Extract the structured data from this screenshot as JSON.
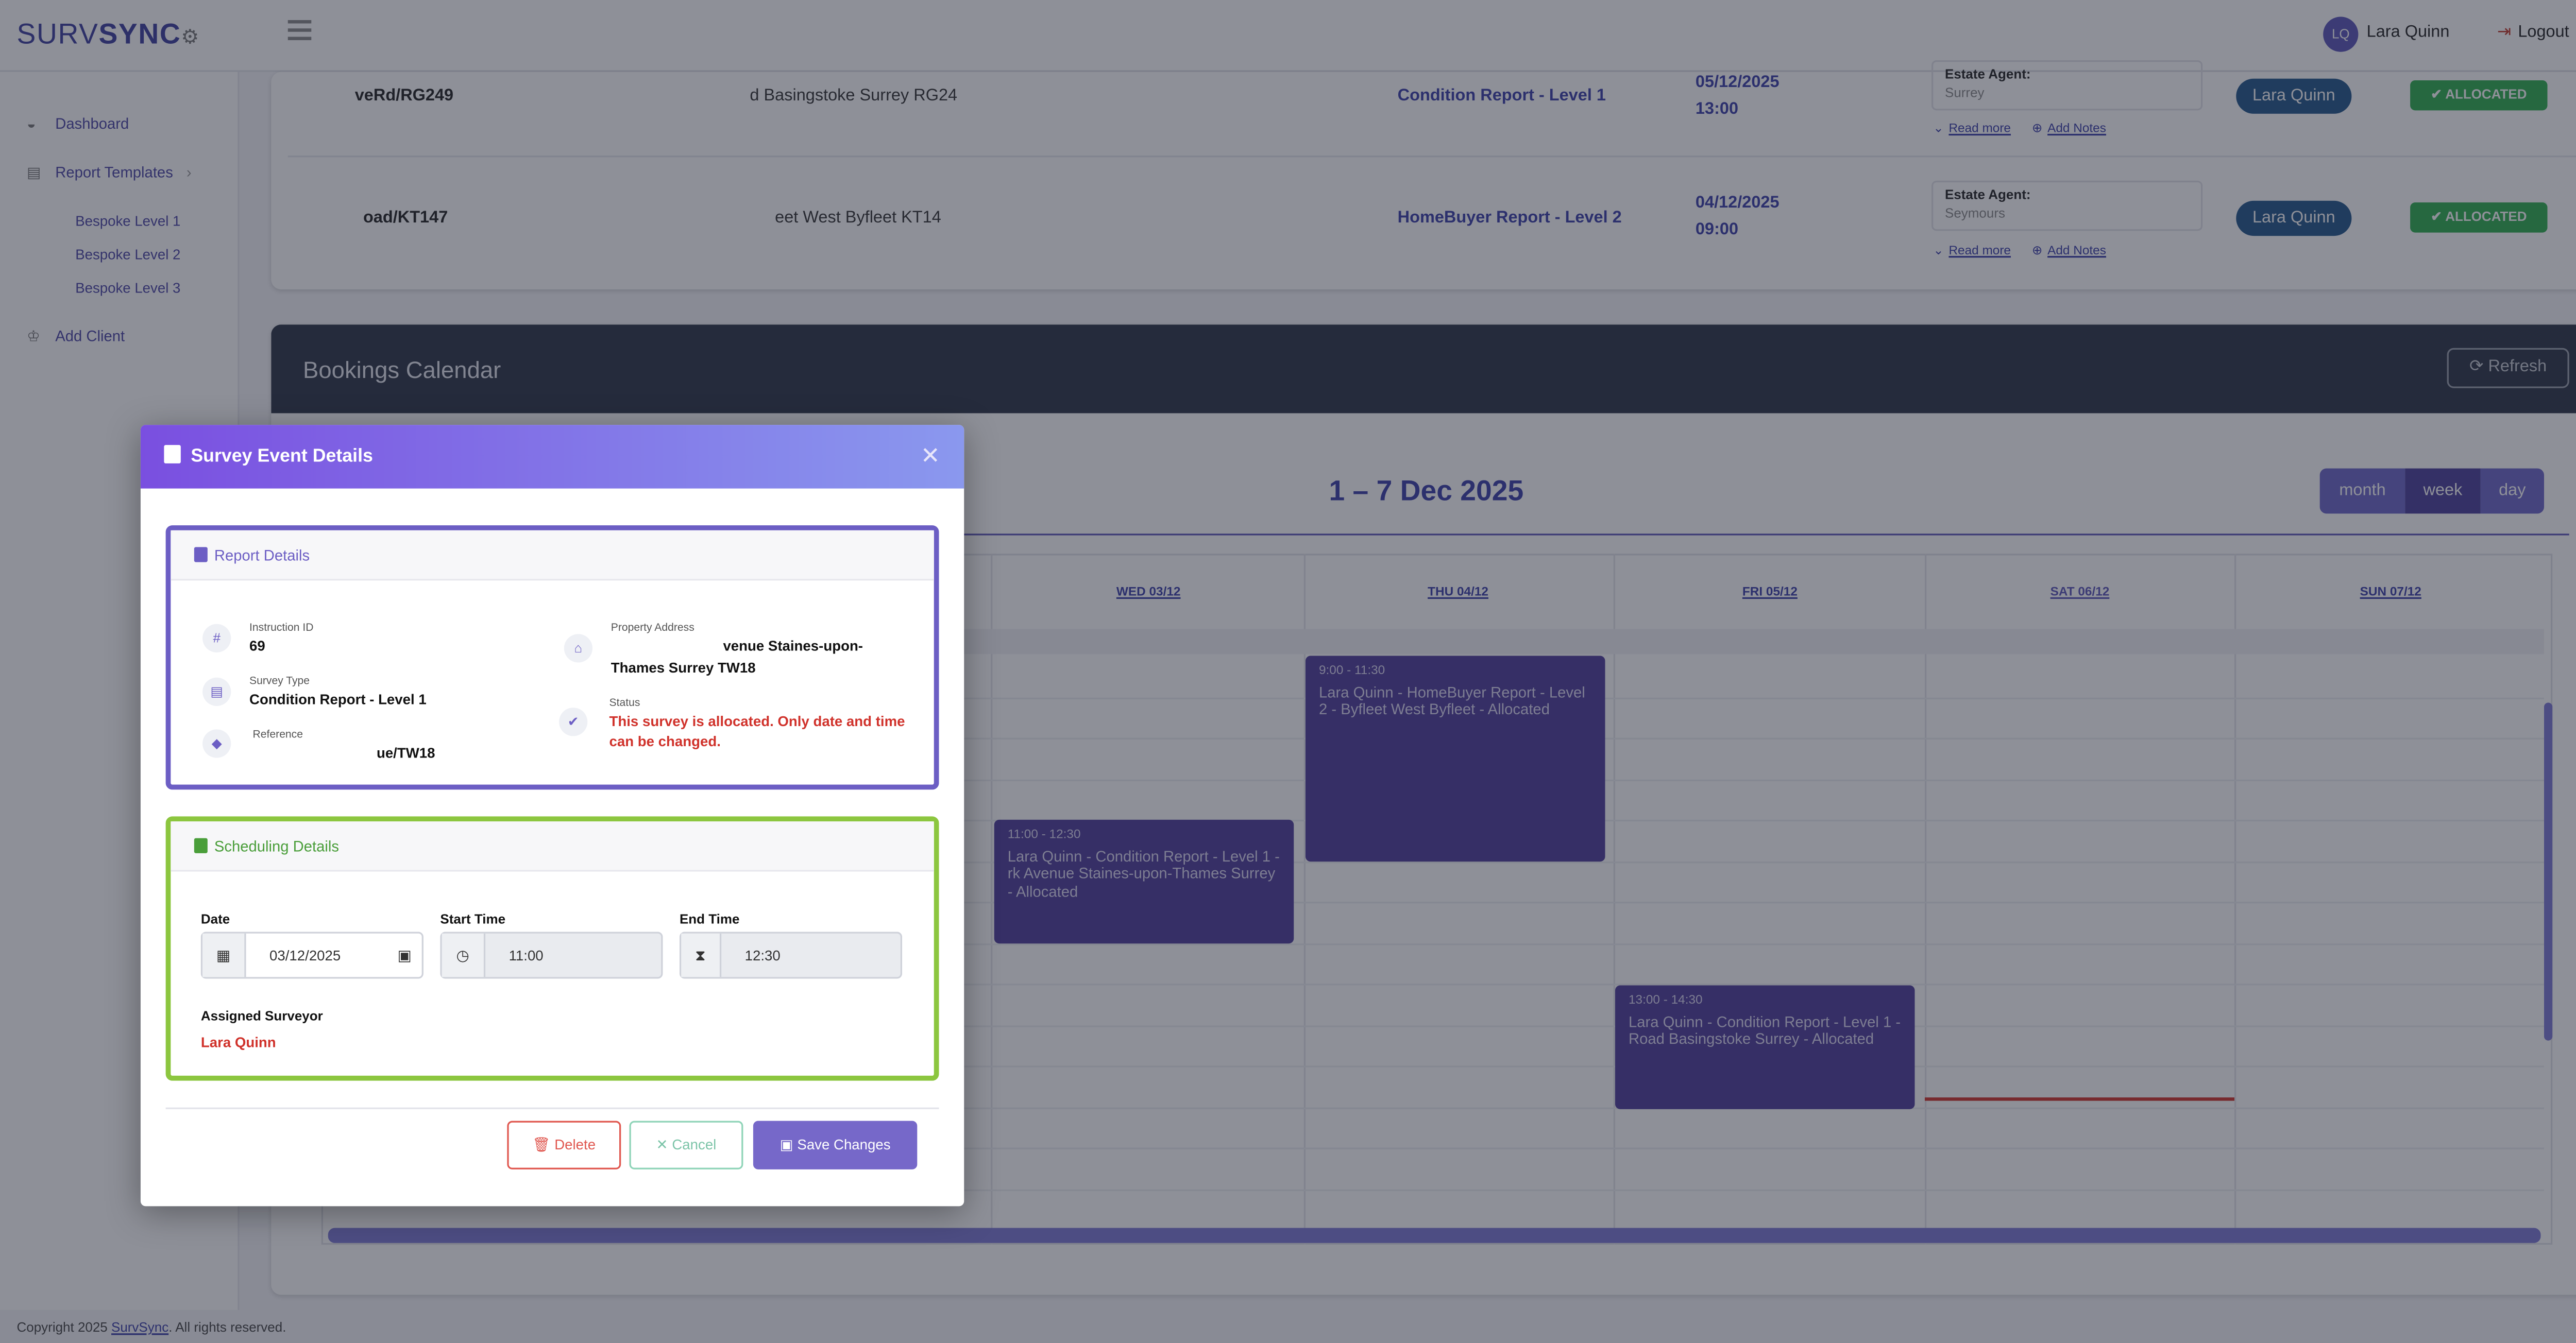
{
  "header": {
    "logo_light": "SURV",
    "logo_bold": "SYNC",
    "avatar_initials": "LQ",
    "user_name": "Lara Quinn",
    "logout_label": "Logout"
  },
  "sidebar": {
    "dashboard": "Dashboard",
    "report_templates": "Report Templates",
    "sub_items": [
      "Bespoke Level 1",
      "Bespoke Level 2",
      "Bespoke Level 3"
    ],
    "add_client": "Add Client"
  },
  "instructions": {
    "rows": [
      {
        "reference": "veRd/RG249",
        "address": "d Basingstoke Surrey RG24",
        "survey_type": "Condition Report - Level 1",
        "date": "05/12/2025",
        "time": "13:00",
        "agent_label": "Estate Agent:",
        "agent_value": "Surrey",
        "read_more": "Read more",
        "add_notes": "Add Notes",
        "surveyor": "Lara Quinn",
        "status": "ALLOCATED"
      },
      {
        "reference": "oad/KT147",
        "address": "eet West Byfleet KT14",
        "survey_type": "HomeBuyer Report - Level 2",
        "date": "04/12/2025",
        "time": "09:00",
        "agent_label": "Estate Agent:",
        "agent_value": "Seymours",
        "read_more": "Read more",
        "add_notes": "Add Notes",
        "surveyor": "Lara Quinn",
        "status": "ALLOCATED"
      }
    ]
  },
  "calendar": {
    "title": "Bookings Calendar",
    "refresh_label": "Refresh",
    "range": "1 – 7 Dec 2025",
    "views": [
      "month",
      "week",
      "day"
    ],
    "days": [
      "WED 03/12",
      "THU 04/12",
      "FRI 05/12",
      "SAT 06/12",
      "SUN 07/12"
    ],
    "events": [
      {
        "time": "9:00 - 11:30",
        "text": "Lara Quinn - HomeBuyer Report - Level 2 - Byfleet West Byfleet - Allocated"
      },
      {
        "time": "11:00 - 12:30",
        "text": "Lara Quinn - Condition Report - Level 1 - rk Avenue Staines-upon-Thames Surrey - Allocated"
      },
      {
        "time": "13:00 - 14:30",
        "text": "Lara Quinn - Condition Report - Level 1 - Road Basingstoke Surrey - Allocated"
      }
    ]
  },
  "footer": {
    "prefix": "Copyright 2025 ",
    "link": "SurvSync",
    "suffix": ". All rights reserved."
  },
  "modal": {
    "title": "Survey Event Details",
    "report_section_title": "Report Details",
    "instruction_id_label": "Instruction ID",
    "instruction_id": "69",
    "survey_type_label": "Survey Type",
    "survey_type": "Condition Report - Level 1",
    "reference_label": "Reference",
    "reference": "ue/TW18",
    "property_address_label": "Property Address",
    "property_address_line1": "venue Staines-upon-",
    "property_address_line2": "Thames Surrey TW18",
    "status_label": "Status",
    "status_line1": "This survey is allocated. Only date and time",
    "status_line2": "can be changed.",
    "scheduling_section_title": "Scheduling Details",
    "date_label": "Date",
    "date_value": "03/12/2025",
    "start_time_label": "Start Time",
    "start_time": "11:00",
    "end_time_label": "End Time",
    "end_time": "12:30",
    "assigned_surveyor_label": "Assigned Surveyor",
    "assigned_surveyor": "Lara Quinn",
    "delete_label": "Delete",
    "cancel_label": "Cancel",
    "save_label": "Save Changes"
  }
}
